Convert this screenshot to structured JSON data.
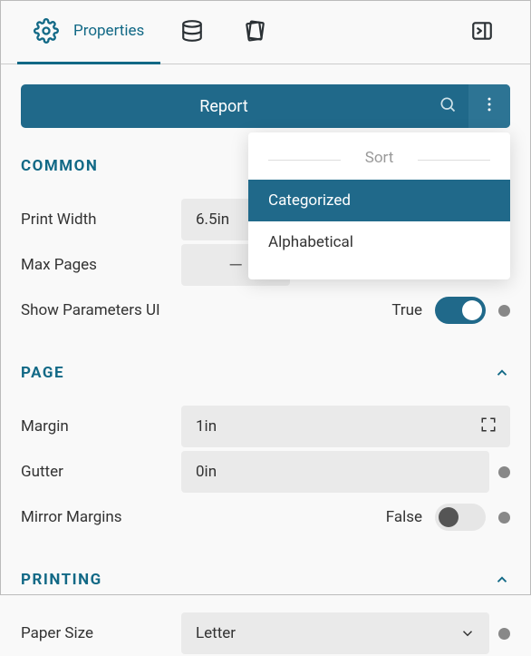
{
  "nav": {
    "properties_label": "Properties"
  },
  "report": {
    "title": "Report"
  },
  "dropdown": {
    "title": "Sort",
    "items": [
      "Categorized",
      "Alphabetical"
    ],
    "selected_index": 0
  },
  "sections": {
    "common": {
      "title": "COMMON",
      "print_width": {
        "label": "Print Width",
        "value": "6.5in"
      },
      "max_pages": {
        "label": "Max Pages",
        "value": "—"
      },
      "show_params": {
        "label": "Show Parameters UI",
        "state_label": "True",
        "on": true
      }
    },
    "page": {
      "title": "PAGE",
      "margin": {
        "label": "Margin",
        "value": "1in"
      },
      "gutter": {
        "label": "Gutter",
        "value": "0in"
      },
      "mirror": {
        "label": "Mirror Margins",
        "state_label": "False",
        "on": false
      }
    },
    "printing": {
      "title": "PRINTING",
      "paper_size": {
        "label": "Paper Size",
        "value": "Letter"
      }
    }
  }
}
